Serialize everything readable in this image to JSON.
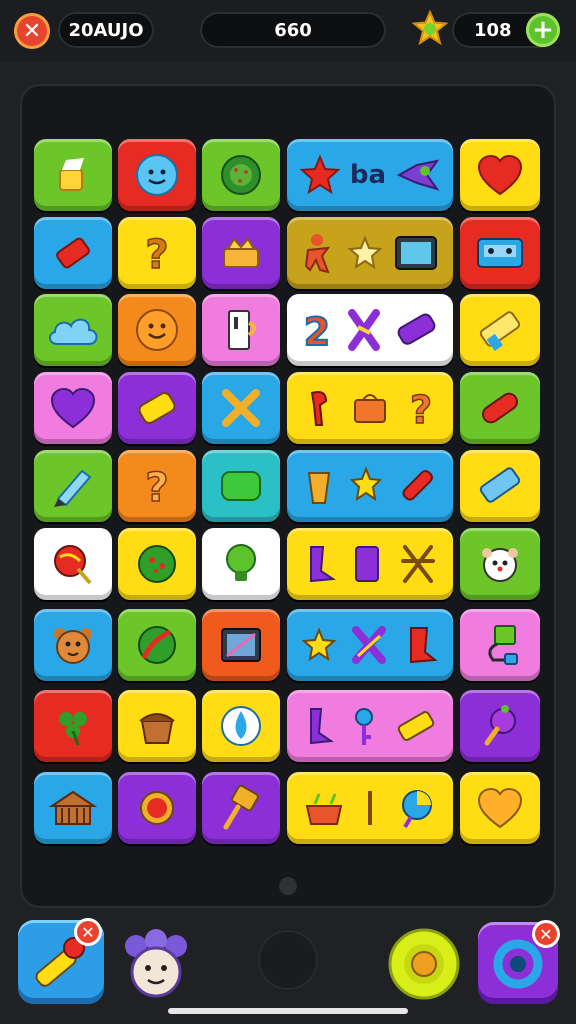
{
  "header": {
    "left_counter": "20AUJO",
    "center_counter": "660",
    "right_counter": "108"
  },
  "icons": {
    "close": "close-icon",
    "star": "star-icon",
    "plus": "plus-icon"
  },
  "colors": {
    "green": "#6cc62a",
    "red": "#e52b22",
    "blue": "#2aa7e6",
    "yellow": "#ffdc14",
    "purple": "#8d2fd8",
    "orange": "#f58a1c",
    "pink": "#f07ce0",
    "white": "#ffffff",
    "olive": "#c7a21b"
  },
  "board": {
    "wide_tile_text": "ba"
  }
}
